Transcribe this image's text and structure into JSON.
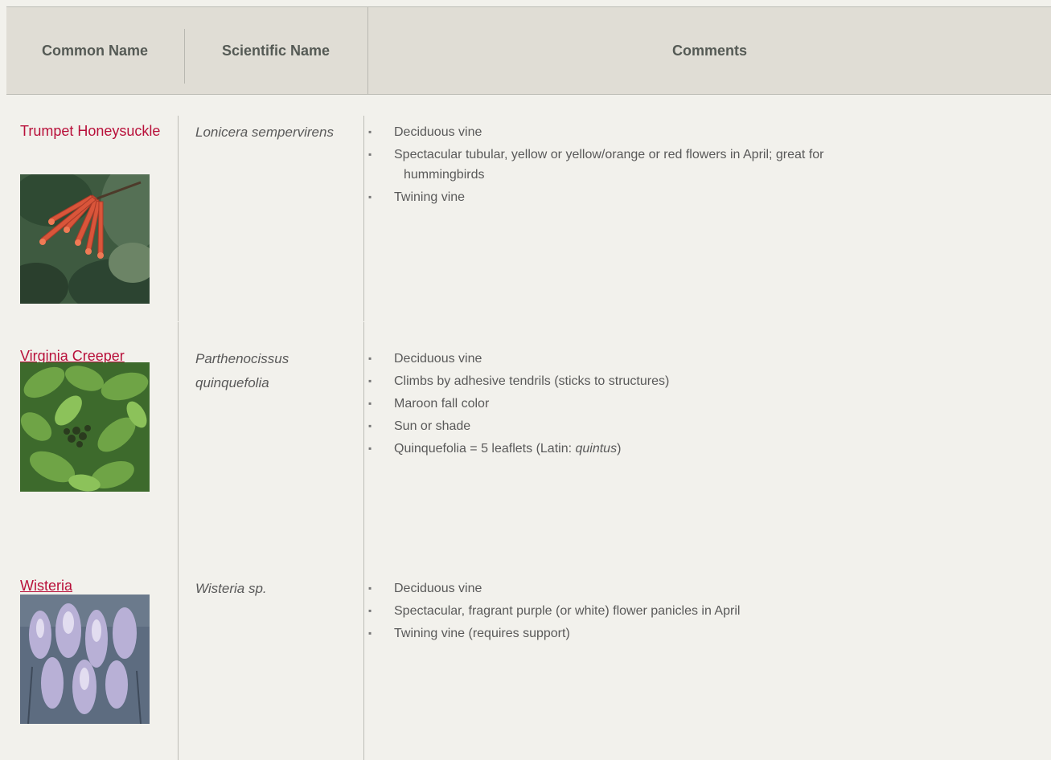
{
  "header": {
    "common_name": "Common Name",
    "scientific_name": "Scientific Name",
    "comments": "Comments"
  },
  "rows": [
    {
      "common_name": "Trumpet Honeysuckle",
      "scientific_name": "Lonicera sempervirens",
      "comments": [
        "Deciduous vine",
        "Spectacular tubular, yellow or yellow/orange or red flowers in April; great for",
        "hummingbirds",
        "Twining vine"
      ]
    },
    {
      "common_name": "Virginia Creeper",
      "scientific_name": "Parthenocissus quinquefolia",
      "comments": [
        "Deciduous vine",
        "Climbs by adhesive tendrils (sticks to structures)",
        "Maroon fall color",
        "Sun or shade",
        "Quinquefolia = 5 leaflets (Latin: ",
        "quintus",
        ")"
      ]
    },
    {
      "common_name": "Wisteria",
      "scientific_name": "Wisteria sp.",
      "comments": [
        "Deciduous vine",
        "Spectacular, fragrant purple (or white) flower panicles in April",
        "Twining vine (requires support)"
      ]
    }
  ],
  "colors": {
    "link": "#b8103a",
    "header_bg": "#e0ddd5",
    "page_bg": "#f2f1ec",
    "text": "#595959"
  }
}
